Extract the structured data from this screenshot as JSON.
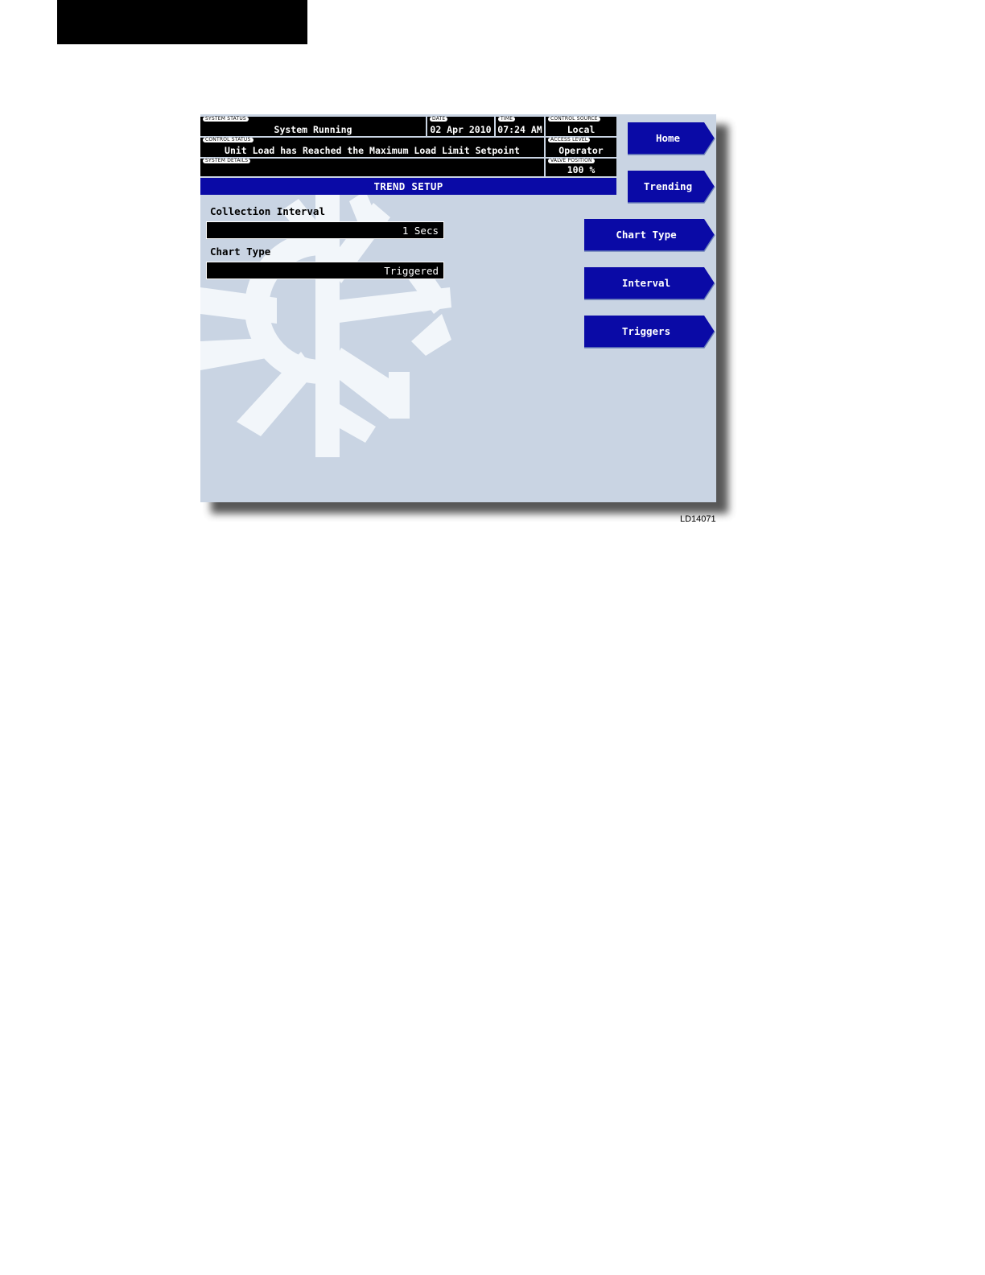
{
  "header": {
    "system_status": {
      "caption": "SYSTEM STATUS",
      "value": "System Running"
    },
    "date": {
      "caption": "DATE",
      "value": "02 Apr 2010"
    },
    "time": {
      "caption": "TIME",
      "value": "07:24 AM"
    },
    "control_source": {
      "caption": "CONTROL SOURCE",
      "value": "Local"
    },
    "control_status": {
      "caption": "CONTROL STATUS",
      "value": "Unit Load has Reached the Maximum Load Limit Setpoint"
    },
    "access_level": {
      "caption": "ACCESS LEVEL",
      "value": "Operator"
    },
    "system_details": {
      "caption": "SYSTEM DETAILS",
      "value": ""
    },
    "valve_position": {
      "caption": "VALVE POSITION",
      "value": "100 %"
    }
  },
  "page_title": "TREND SETUP",
  "fields": {
    "collection_interval": {
      "label": "Collection Interval",
      "value": "1 Secs"
    },
    "chart_type": {
      "label": "Chart Type",
      "value": "Triggered"
    }
  },
  "nav_buttons": {
    "home": "Home",
    "trending": "Trending"
  },
  "action_buttons": {
    "chart_type": "Chart Type",
    "interval": "Interval",
    "triggers": "Triggers"
  },
  "figure_id": "LD14071",
  "colors": {
    "button_blue": "#0a0aa6",
    "screen_background": "#c9d4e3",
    "logo_white": "#f2f5f8"
  },
  "icons": {
    "background_logo": "snowflake-icon"
  }
}
